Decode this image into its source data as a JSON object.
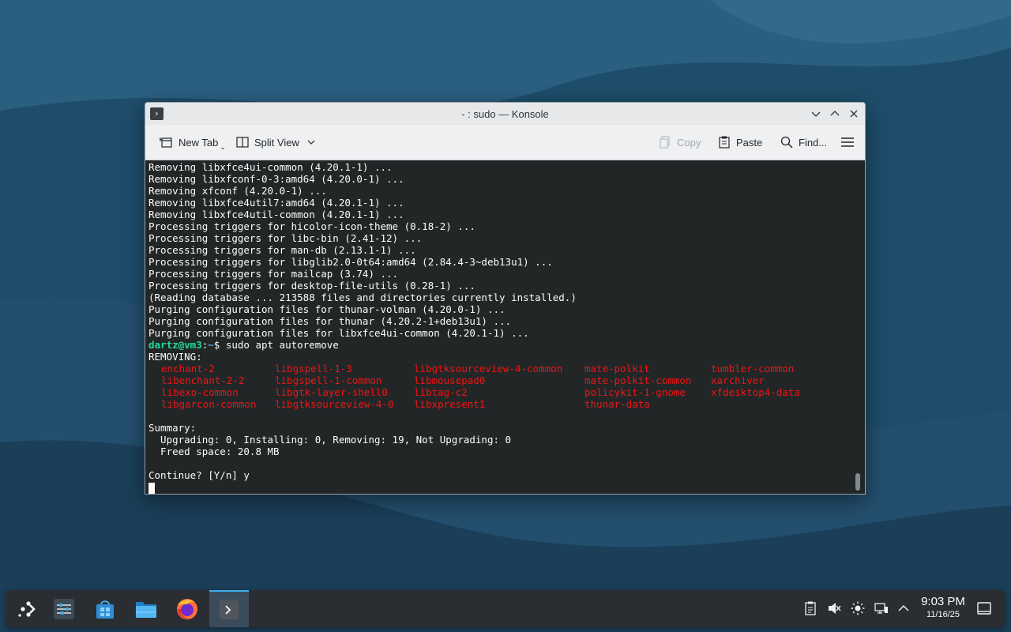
{
  "window": {
    "title": "- : sudo — Konsole",
    "icon": "konsole-icon"
  },
  "toolbar": {
    "new_tab": "New Tab",
    "split_view": "Split View",
    "copy": "Copy",
    "paste": "Paste",
    "find": "Find..."
  },
  "terminal": {
    "lines_before": [
      "Removing libxfce4ui-common (4.20.1-1) ...",
      "Removing libxfconf-0-3:amd64 (4.20.0-1) ...",
      "Removing xfconf (4.20.0-1) ...",
      "Removing libxfce4util7:amd64 (4.20.1-1) ...",
      "Removing libxfce4util-common (4.20.1-1) ...",
      "Processing triggers for hicolor-icon-theme (0.18-2) ...",
      "Processing triggers for libc-bin (2.41-12) ...",
      "Processing triggers for man-db (2.13.1-1) ...",
      "Processing triggers for libglib2.0-0t64:amd64 (2.84.4-3~deb13u1) ...",
      "Processing triggers for mailcap (3.74) ...",
      "Processing triggers for desktop-file-utils (0.28-1) ...",
      "(Reading database ... 213588 files and directories currently installed.)",
      "Purging configuration files for thunar-volman (4.20.0-1) ...",
      "Purging configuration files for thunar (4.20.2-1+deb13u1) ...",
      "Purging configuration files for libxfce4ui-common (4.20.1-1) ..."
    ],
    "prompt_user": "dartz@vm3",
    "prompt_sep": ":",
    "prompt_path": "~",
    "prompt_symbol": "$",
    "command": " sudo apt autoremove",
    "removing_header": "REMOVING:",
    "removing_packages": [
      "enchant-2",
      "libgspell-1-3",
      "libgtksourceview-4-common",
      "mate-polkit",
      "tumbler-common",
      "libenchant-2-2",
      "libgspell-1-common",
      "libmousepad0",
      "mate-polkit-common",
      "xarchiver",
      "libexo-common",
      "libgtk-layer-shell0",
      "libtag-c2",
      "policykit-1-gnome",
      "xfdesktop4-data",
      "libgarcon-common",
      "libgtksourceview-4-0",
      "libxpresent1",
      "thunar-data",
      ""
    ],
    "summary_header": "Summary:",
    "summary_line1": "  Upgrading: 0, Installing: 0, Removing: 19, Not Upgrading: 0",
    "summary_line2": "  Freed space: 20.8 MB",
    "continue_prompt": "Continue? [Y/n] y"
  },
  "taskbar": {
    "apps": [
      "application-launcher-icon",
      "system-settings-icon",
      "discover-icon",
      "file-manager-icon",
      "firefox-icon",
      "konsole-icon"
    ],
    "tray": [
      "clipboard-icon",
      "volume-muted-icon",
      "brightness-icon",
      "network-icon",
      "expand-tray-icon",
      "show-desktop-icon"
    ],
    "clock_time": "9:03 PM",
    "clock_date": "11/16/25"
  },
  "colors": {
    "terminal_bg": "#232627",
    "prompt_user": "#1cdc9a",
    "prompt_path": "#3daee9",
    "removing_red": "#ed1515",
    "taskbar_bg": "#2a2e32"
  }
}
